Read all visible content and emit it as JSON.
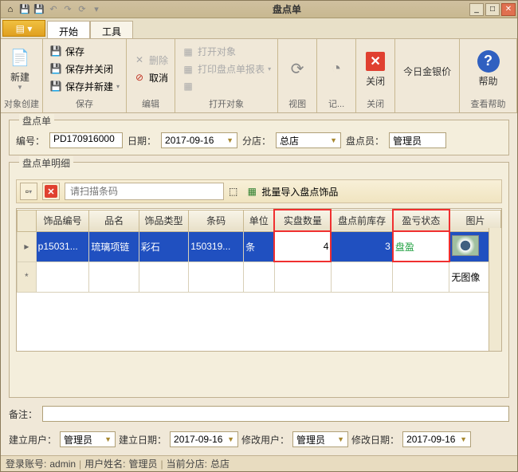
{
  "window": {
    "title": "盘点单"
  },
  "tabs": {
    "start": "开始",
    "tools": "工具"
  },
  "ribbon": {
    "create": {
      "new": "新建",
      "group": "对象创建"
    },
    "save": {
      "save": "保存",
      "save_close": "保存并关闭",
      "save_new": "保存并新建",
      "group": "保存"
    },
    "edit": {
      "delete": "删除",
      "cancel": "取消",
      "group": "编辑"
    },
    "open": {
      "open_obj": "打开对象",
      "print_report": "打印盘点单报表",
      "group": "打开对象"
    },
    "view": {
      "group": "视图"
    },
    "log": {
      "group": "记..."
    },
    "close": {
      "close": "关闭",
      "group": "关闭"
    },
    "price": {
      "today": "今日金银价"
    },
    "help": {
      "help": "帮助",
      "group": "查看帮助"
    }
  },
  "header": {
    "title": "盘点单",
    "no_label": "编号：",
    "no_value": "PD170916000",
    "date_label": "日期：",
    "date_value": "2017-09-16",
    "branch_label": "分店：",
    "branch_value": "总店",
    "clerk_label": "盘点员：",
    "clerk_value": "管理员"
  },
  "detail": {
    "title": "盘点单明细",
    "search_placeholder": "请扫描条码",
    "bulk_import": "批量导入盘点饰品",
    "columns": [
      "饰品编号",
      "品名",
      "饰品类型",
      "条码",
      "单位",
      "实盘数量",
      "盘点前库存",
      "盈亏状态",
      "图片"
    ],
    "rows": [
      {
        "code": "p15031...",
        "name": "琉璃项链",
        "type": "彩石",
        "barcode": "150319...",
        "unit": "条",
        "actual": "4",
        "before": "3",
        "status": "盘盈",
        "img": true
      },
      {
        "code": "",
        "name": "",
        "type": "",
        "barcode": "",
        "unit": "",
        "actual": "",
        "before": "",
        "status": "",
        "img": false,
        "img_text": "无图像"
      }
    ]
  },
  "remark": {
    "label": "备注：",
    "value": ""
  },
  "meta": {
    "create_user_label": "建立用户：",
    "create_user": "管理员",
    "create_date_label": "建立日期：",
    "create_date": "2017-09-16",
    "mod_user_label": "修改用户：",
    "mod_user": "管理员",
    "mod_date_label": "修改日期：",
    "mod_date": "2017-09-16"
  },
  "status": {
    "account_label": "登录账号:",
    "account": "admin",
    "user_label": "用户姓名:",
    "user": "管理员",
    "branch_label": "当前分店:",
    "branch": "总店"
  }
}
